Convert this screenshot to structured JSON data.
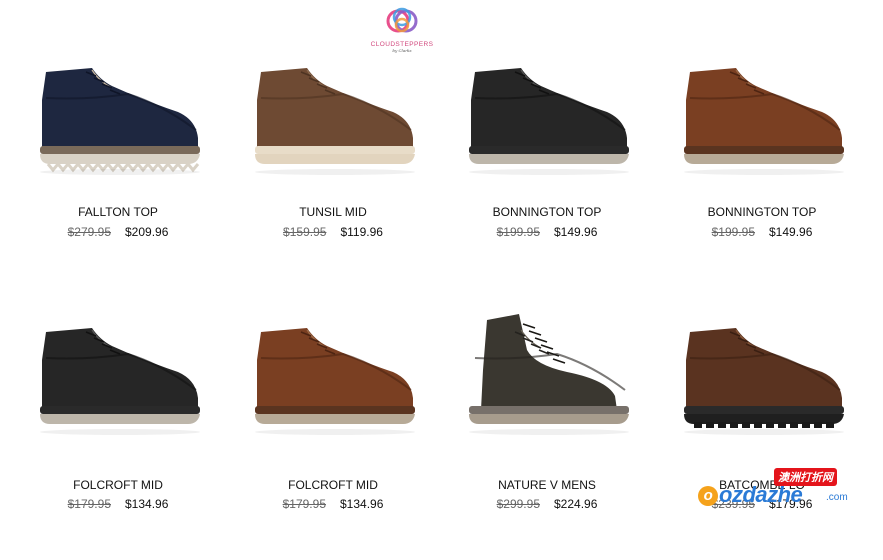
{
  "brand": {
    "logo_text": "CLOUDSTEPPERS",
    "logo_sub": "by Clarks",
    "logo_icon": "cloudsteppers-swirl-icon",
    "colors": {
      "pink": "#e8508c",
      "purple": "#8a5cc7",
      "blue": "#3c9be0",
      "orange": "#f29a3c"
    }
  },
  "products": [
    {
      "name": "FALLTON TOP",
      "was": "$279.95",
      "now": "$209.96",
      "image": "navy-leather-chukka-boot"
    },
    {
      "name": "TUNSIL MID",
      "was": "$159.95",
      "now": "$119.96",
      "image": "brown-nubuck-chukka-boot"
    },
    {
      "name": "BONNINGTON TOP",
      "was": "$199.95",
      "now": "$149.96",
      "image": "black-leather-chukka-boot"
    },
    {
      "name": "BONNINGTON TOP",
      "was": "$199.95",
      "now": "$149.96",
      "image": "tan-leather-chukka-boot"
    },
    {
      "name": "FOLCROFT MID",
      "was": "$179.95",
      "now": "$134.96",
      "image": "black-leather-chukka-boot"
    },
    {
      "name": "FOLCROFT MID",
      "was": "$179.95",
      "now": "$134.96",
      "image": "tan-leather-chukka-boot"
    },
    {
      "name": "NATURE V MENS",
      "was": "$299.95",
      "now": "$224.96",
      "image": "dark-olive-high-top-boot"
    },
    {
      "name": "BATCOMBE LO",
      "was": "$239.95",
      "now": "$179.96",
      "image": "brown-lug-sole-chukka-boot"
    }
  ],
  "watermark": {
    "badge": "澳洲打折网",
    "main": "ozdazhe",
    "domain": ".com"
  }
}
